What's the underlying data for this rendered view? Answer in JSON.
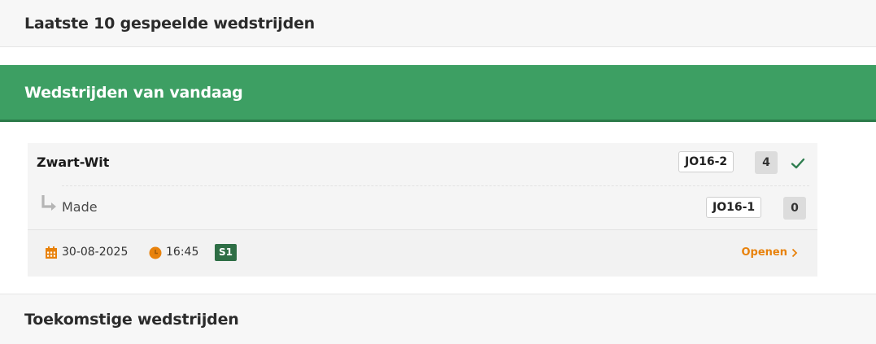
{
  "sections": {
    "last_played_title": "Laatste 10 gespeelde wedstrijden",
    "today_title": "Wedstrijden van vandaag",
    "upcoming_title": "Toekomstige wedstrijden"
  },
  "match": {
    "home_team": "Zwart-Wit",
    "home_team_badge": "JO16-2",
    "home_score": "4",
    "away_team": "Made",
    "away_team_badge": "JO16-1",
    "away_score": "0",
    "date": "30-08-2025",
    "time": "16:45",
    "field": "S1",
    "open_label": "Openen"
  },
  "icons": {
    "calendar": "calendar-icon",
    "clock": "clock-icon",
    "check": "check-icon",
    "reply_arrow": "reply-arrow-icon",
    "chevron": "chevron-right-icon"
  },
  "colors": {
    "today_header": "#3d9f63",
    "accent_orange": "#e8820c",
    "check_green": "#2e7d4f",
    "field_badge": "#2e6e45"
  }
}
